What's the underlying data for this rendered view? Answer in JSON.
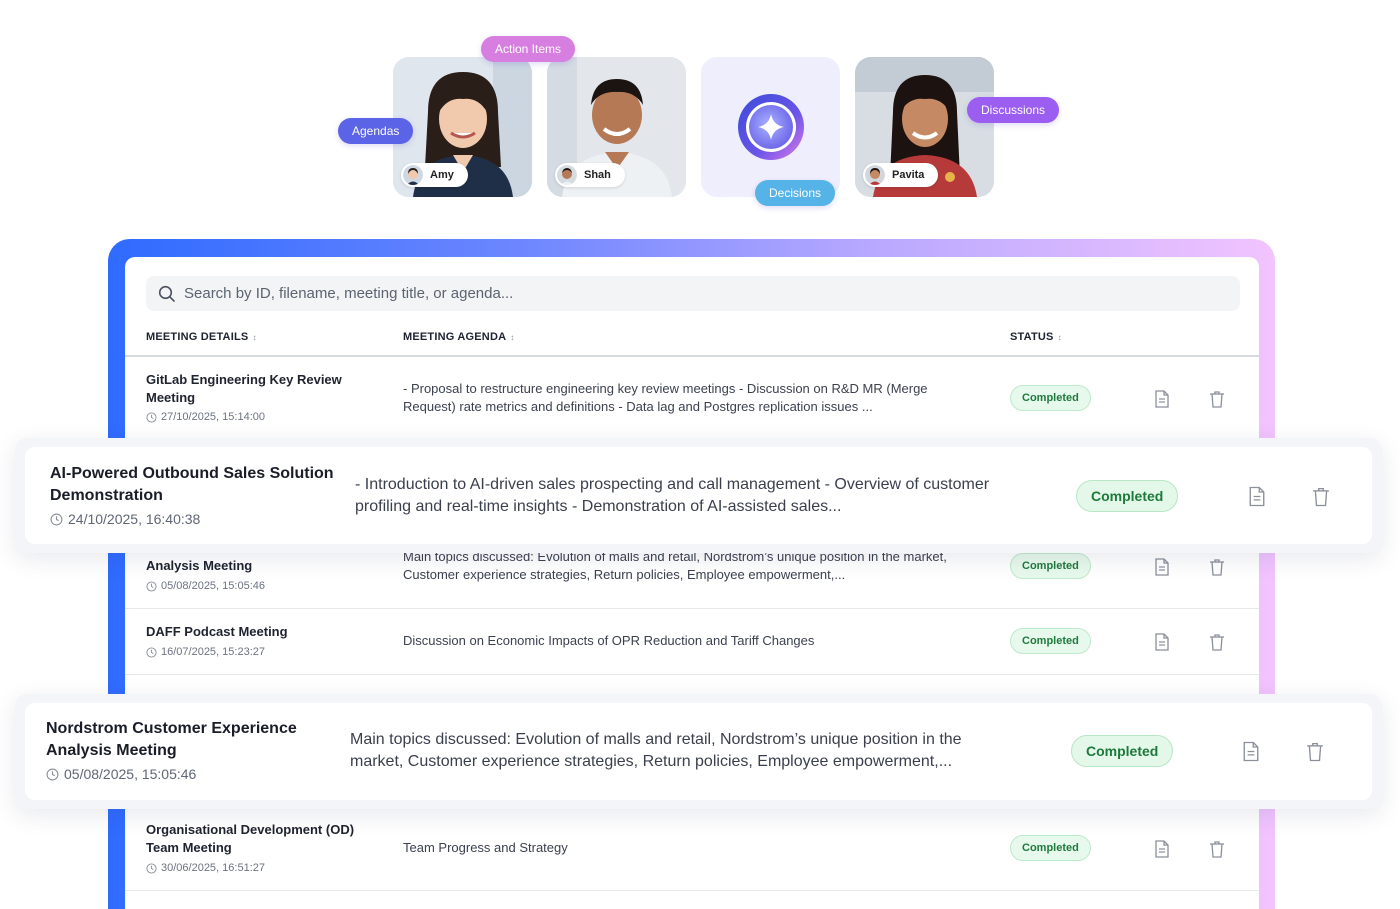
{
  "participants": [
    {
      "name": "Amy"
    },
    {
      "name": "Shah"
    },
    {
      "name": "Pavita"
    }
  ],
  "tags": {
    "agendas": "Agendas",
    "action_items": "Action Items",
    "decisions": "Decisions",
    "discussions": "Discussions"
  },
  "search": {
    "placeholder": "Search by ID, filename, meeting title, or agenda..."
  },
  "columns": {
    "details": "MEETING DETAILS",
    "agenda": "MEETING AGENDA",
    "status": "STATUS"
  },
  "rows": [
    {
      "title": "GitLab Engineering Key Review Meeting",
      "date": "27/10/2025, 15:14:00",
      "agenda": "- Proposal to restructure engineering key review meetings - Discussion on R&D MR (Merge Request) rate metrics and definitions - Data lag and Postgres replication issues ...",
      "status": "Completed"
    },
    {
      "title": "Analysis Meeting",
      "date": "05/08/2025, 15:05:46",
      "agenda": "Main topics discussed: Evolution of malls and retail, Nordstrom’s unique position in the market, Customer experience strategies, Return policies, Employee empowerment,...",
      "status": "Completed"
    },
    {
      "title": "DAFF Podcast Meeting",
      "date": "16/07/2025, 15:23:27",
      "agenda": "Discussion on Economic Impacts of OPR Reduction and Tariff Changes",
      "status": "Completed"
    },
    {
      "title": "Organisational Development (OD) Team Meeting",
      "date": "30/06/2025, 16:51:27",
      "agenda": "Team Progress and Strategy",
      "status": "Completed"
    }
  ],
  "highlight_cards": [
    {
      "title": "AI-Powered Outbound Sales Solution Demonstration",
      "date": "24/10/2025, 16:40:38",
      "agenda": "- Introduction to AI-driven sales prospecting and call management - Overview of customer profiling and real-time insights - Demonstration of AI-assisted sales...",
      "status": "Completed"
    },
    {
      "title": "Nordstrom Customer Experience Analysis Meeting",
      "date": "05/08/2025, 15:05:46",
      "agenda": "Main topics discussed: Evolution of malls and retail, Nordstrom’s unique position in the market, Customer experience strategies, Return policies, Employee empowerment,...",
      "status": "Completed"
    }
  ],
  "colors": {
    "agendas_tag": "#5b63e6",
    "action_items_tag": "#d77fe0",
    "decisions_tag": "#56b3e8",
    "discussions_tag": "#9b5ef0",
    "status_green": "#1f7a3d",
    "frame_start": "#2f6bff",
    "frame_end": "#f2c4ff"
  },
  "icons": [
    "search-icon",
    "clock-icon",
    "document-icon",
    "trash-icon",
    "ai-sparkle-icon"
  ]
}
